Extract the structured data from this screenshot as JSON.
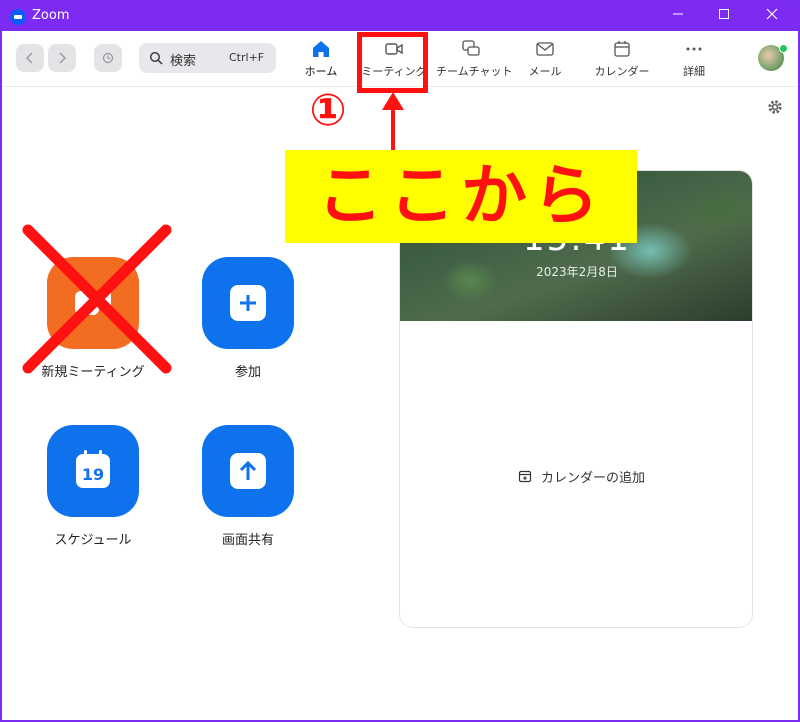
{
  "window": {
    "title": "Zoom"
  },
  "toolbar": {
    "search_label": "検索",
    "search_shortcut": "Ctrl+F",
    "tabs": [
      {
        "label": "ホーム",
        "icon": "home-icon"
      },
      {
        "label": "ミーティング",
        "icon": "video-camera-icon"
      },
      {
        "label": "チームチャット",
        "icon": "chat-bubbles-icon"
      },
      {
        "label": "メール",
        "icon": "mail-icon"
      },
      {
        "label": "カレンダー",
        "icon": "calendar-icon"
      },
      {
        "label": "詳細",
        "icon": "more-dots-icon"
      }
    ]
  },
  "actions": [
    {
      "label": "新規ミーティング",
      "icon": "video-camera-icon",
      "color": "#f26d21"
    },
    {
      "label": "参加",
      "icon": "plus-icon",
      "color": "#0e72ed"
    },
    {
      "label": "スケジュール",
      "icon": "calendar-19-icon",
      "color": "#0e72ed",
      "icon_text": "19"
    },
    {
      "label": "画面共有",
      "icon": "share-arrow-up-icon",
      "color": "#0e72ed"
    }
  ],
  "card": {
    "time": "15:41",
    "date": "2023年2月8日",
    "add_calendar_label": "カレンダーの追加"
  },
  "annotations": {
    "step_number": "①",
    "banner_text": "ここから",
    "highlight_color": "#ff1111",
    "banner_color": "#ffff00"
  },
  "colors": {
    "title_bar": "#7d2af2",
    "accent_blue": "#0e72ed",
    "orange": "#f26d21"
  }
}
